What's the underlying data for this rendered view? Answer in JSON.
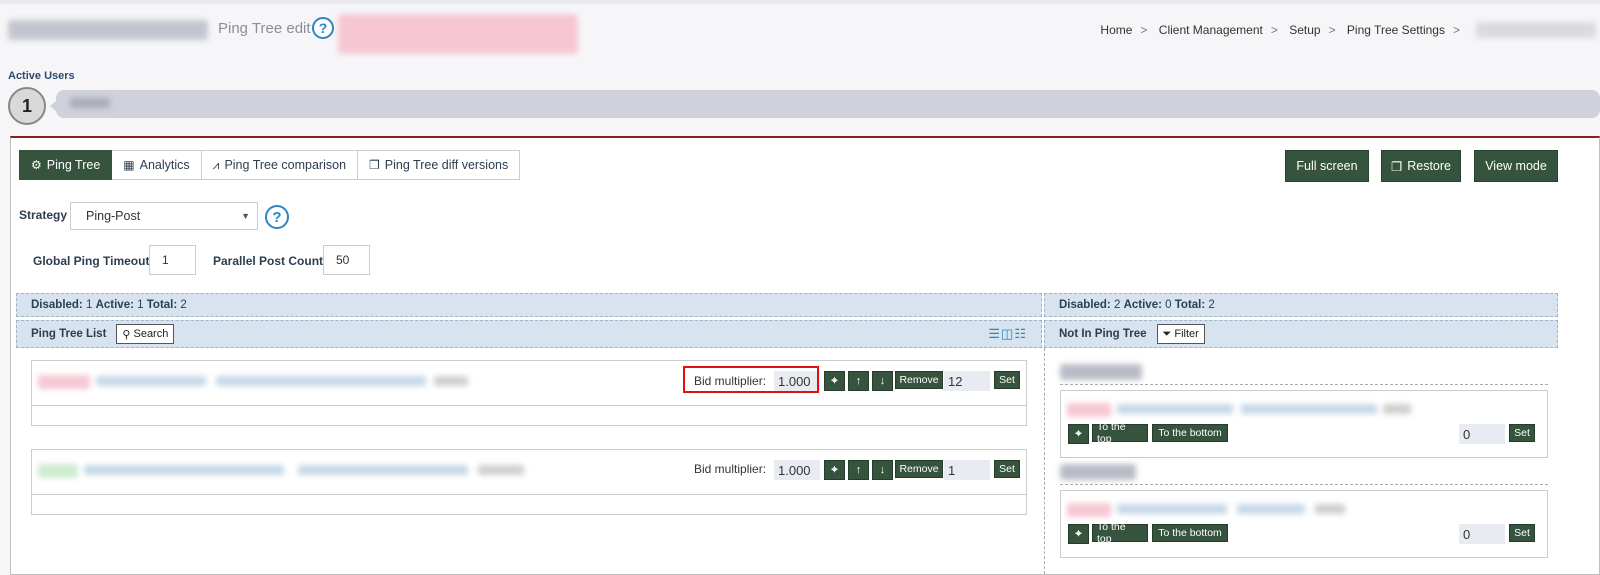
{
  "header": {
    "subtitle": "Ping Tree edit",
    "breadcrumb": [
      "Home",
      "Client Management",
      "Setup",
      "Ping Tree Settings"
    ]
  },
  "active_users": {
    "label": "Active Users",
    "count": "1"
  },
  "tabs": [
    {
      "label": "Ping Tree",
      "icon": "gears-icon"
    },
    {
      "label": "Analytics",
      "icon": "calendar-icon"
    },
    {
      "label": "Ping Tree comparison",
      "icon": "chart-line-icon"
    },
    {
      "label": "Ping Tree diff versions",
      "icon": "copy-icon"
    }
  ],
  "toolbar": {
    "full_screen": "Full screen",
    "restore": "Restore",
    "view_mode": "View mode"
  },
  "settings": {
    "strategy_label": "Strategy",
    "strategy_value": "Ping-Post",
    "global_ping_timeout_label": "Global Ping Timeout",
    "global_ping_timeout_value": "1",
    "parallel_post_count_label": "Parallel Post Count",
    "parallel_post_count_value": "50"
  },
  "left_panel": {
    "stats": {
      "disabled_label": "Disabled:",
      "disabled": "1",
      "active_label": "Active:",
      "active": "1",
      "total_label": "Total:",
      "total": "2"
    },
    "title": "Ping Tree List",
    "search_label": "Search",
    "items": [
      {
        "bid_label": "Bid multiplier:",
        "bid_value": "1.000",
        "remove_label": "Remove",
        "qty": "12",
        "set_label": "Set",
        "status_color": "#f6c7d3"
      },
      {
        "bid_label": "Bid multiplier:",
        "bid_value": "1.000",
        "remove_label": "Remove",
        "qty": "1",
        "set_label": "Set",
        "status_color": "#cdeccf"
      }
    ]
  },
  "right_panel": {
    "stats": {
      "disabled_label": "Disabled:",
      "disabled": "2",
      "active_label": "Active:",
      "active": "0",
      "total_label": "Total:",
      "total": "2"
    },
    "title": "Not In Ping Tree",
    "filter_label": "Filter",
    "items": [
      {
        "top_label": "To the top",
        "bottom_label": "To the bottom",
        "qty": "0",
        "set_label": "Set"
      },
      {
        "top_label": "To the top",
        "bottom_label": "To the bottom",
        "qty": "0",
        "set_label": "Set"
      }
    ]
  },
  "colors": {
    "accent_green": "#35533d",
    "help_blue": "#2a86c4",
    "panel_top_border": "#8b1e1e",
    "highlight_red": "#e01010"
  }
}
